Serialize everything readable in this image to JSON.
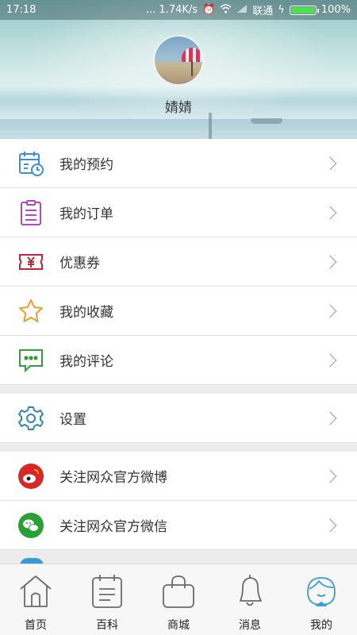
{
  "status_bar": {
    "time": "17:18",
    "network_speed": "... 1.74K/s",
    "carrier": "联通",
    "battery": "100%"
  },
  "profile": {
    "username": "婧婧"
  },
  "menu_section_1": [
    {
      "label": "我的预约",
      "icon": "calendar-clock-icon"
    },
    {
      "label": "我的订单",
      "icon": "clipboard-icon"
    },
    {
      "label": "优惠券",
      "icon": "coupon-yen-icon"
    },
    {
      "label": "我的收藏",
      "icon": "star-icon"
    },
    {
      "label": "我的评论",
      "icon": "chat-bubble-icon"
    }
  ],
  "menu_section_2": [
    {
      "label": "设置",
      "icon": "gear-icon"
    }
  ],
  "menu_section_3": [
    {
      "label": "关注网众官方微博",
      "icon": "weibo-icon"
    },
    {
      "label": "关注网众官方微信",
      "icon": "wechat-icon"
    }
  ],
  "tabbar": [
    {
      "label": "首页",
      "icon": "home-icon"
    },
    {
      "label": "百科",
      "icon": "notebook-icon"
    },
    {
      "label": "商城",
      "icon": "shopping-bag-icon"
    },
    {
      "label": "消息",
      "icon": "bell-icon"
    },
    {
      "label": "我的",
      "icon": "profile-face-icon",
      "active": true
    }
  ],
  "colors": {
    "calendar": "#3a8fd6",
    "clipboard": "#b04bbf",
    "coupon": "#c4253b",
    "star": "#f29b2b",
    "chat": "#3a9a3a",
    "gear": "#2f86b7",
    "weibo": "#d92727",
    "wechat": "#2aa034",
    "tab_active": "#3a9ad9"
  }
}
